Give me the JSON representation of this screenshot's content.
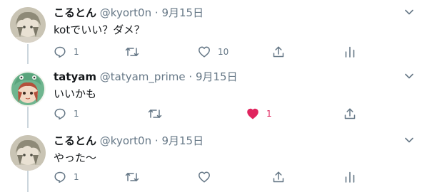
{
  "tweets": [
    {
      "name": "こるとん",
      "handle": "@kyort0n",
      "separator": "·",
      "date": "9月15日",
      "text": "kotでいい？ダメ？",
      "reply_count": "1",
      "retweet_count": "",
      "like_count": "10",
      "liked": false,
      "avatar": "avatar-kyort0n"
    },
    {
      "name": "tatyam",
      "handle": "@tatyam_prime",
      "separator": "·",
      "date": "9月15日",
      "text": "いいかも",
      "reply_count": "1",
      "retweet_count": "",
      "like_count": "1",
      "liked": true,
      "avatar": "avatar-tatyam"
    },
    {
      "name": "こるとん",
      "handle": "@kyort0n",
      "separator": "·",
      "date": "9月15日",
      "text": "やった〜",
      "reply_count": "1",
      "retweet_count": "",
      "like_count": "",
      "liked": false,
      "avatar": "avatar-kyort0n"
    }
  ],
  "colors": {
    "text_primary": "#14171a",
    "text_secondary": "#657786",
    "icon": "#657786",
    "like_active": "#e0245e",
    "thread_line": "#ccd6dd"
  },
  "icons": [
    "chevron-down-icon",
    "reply-icon",
    "retweet-icon",
    "like-icon",
    "share-icon",
    "analytics-icon"
  ]
}
